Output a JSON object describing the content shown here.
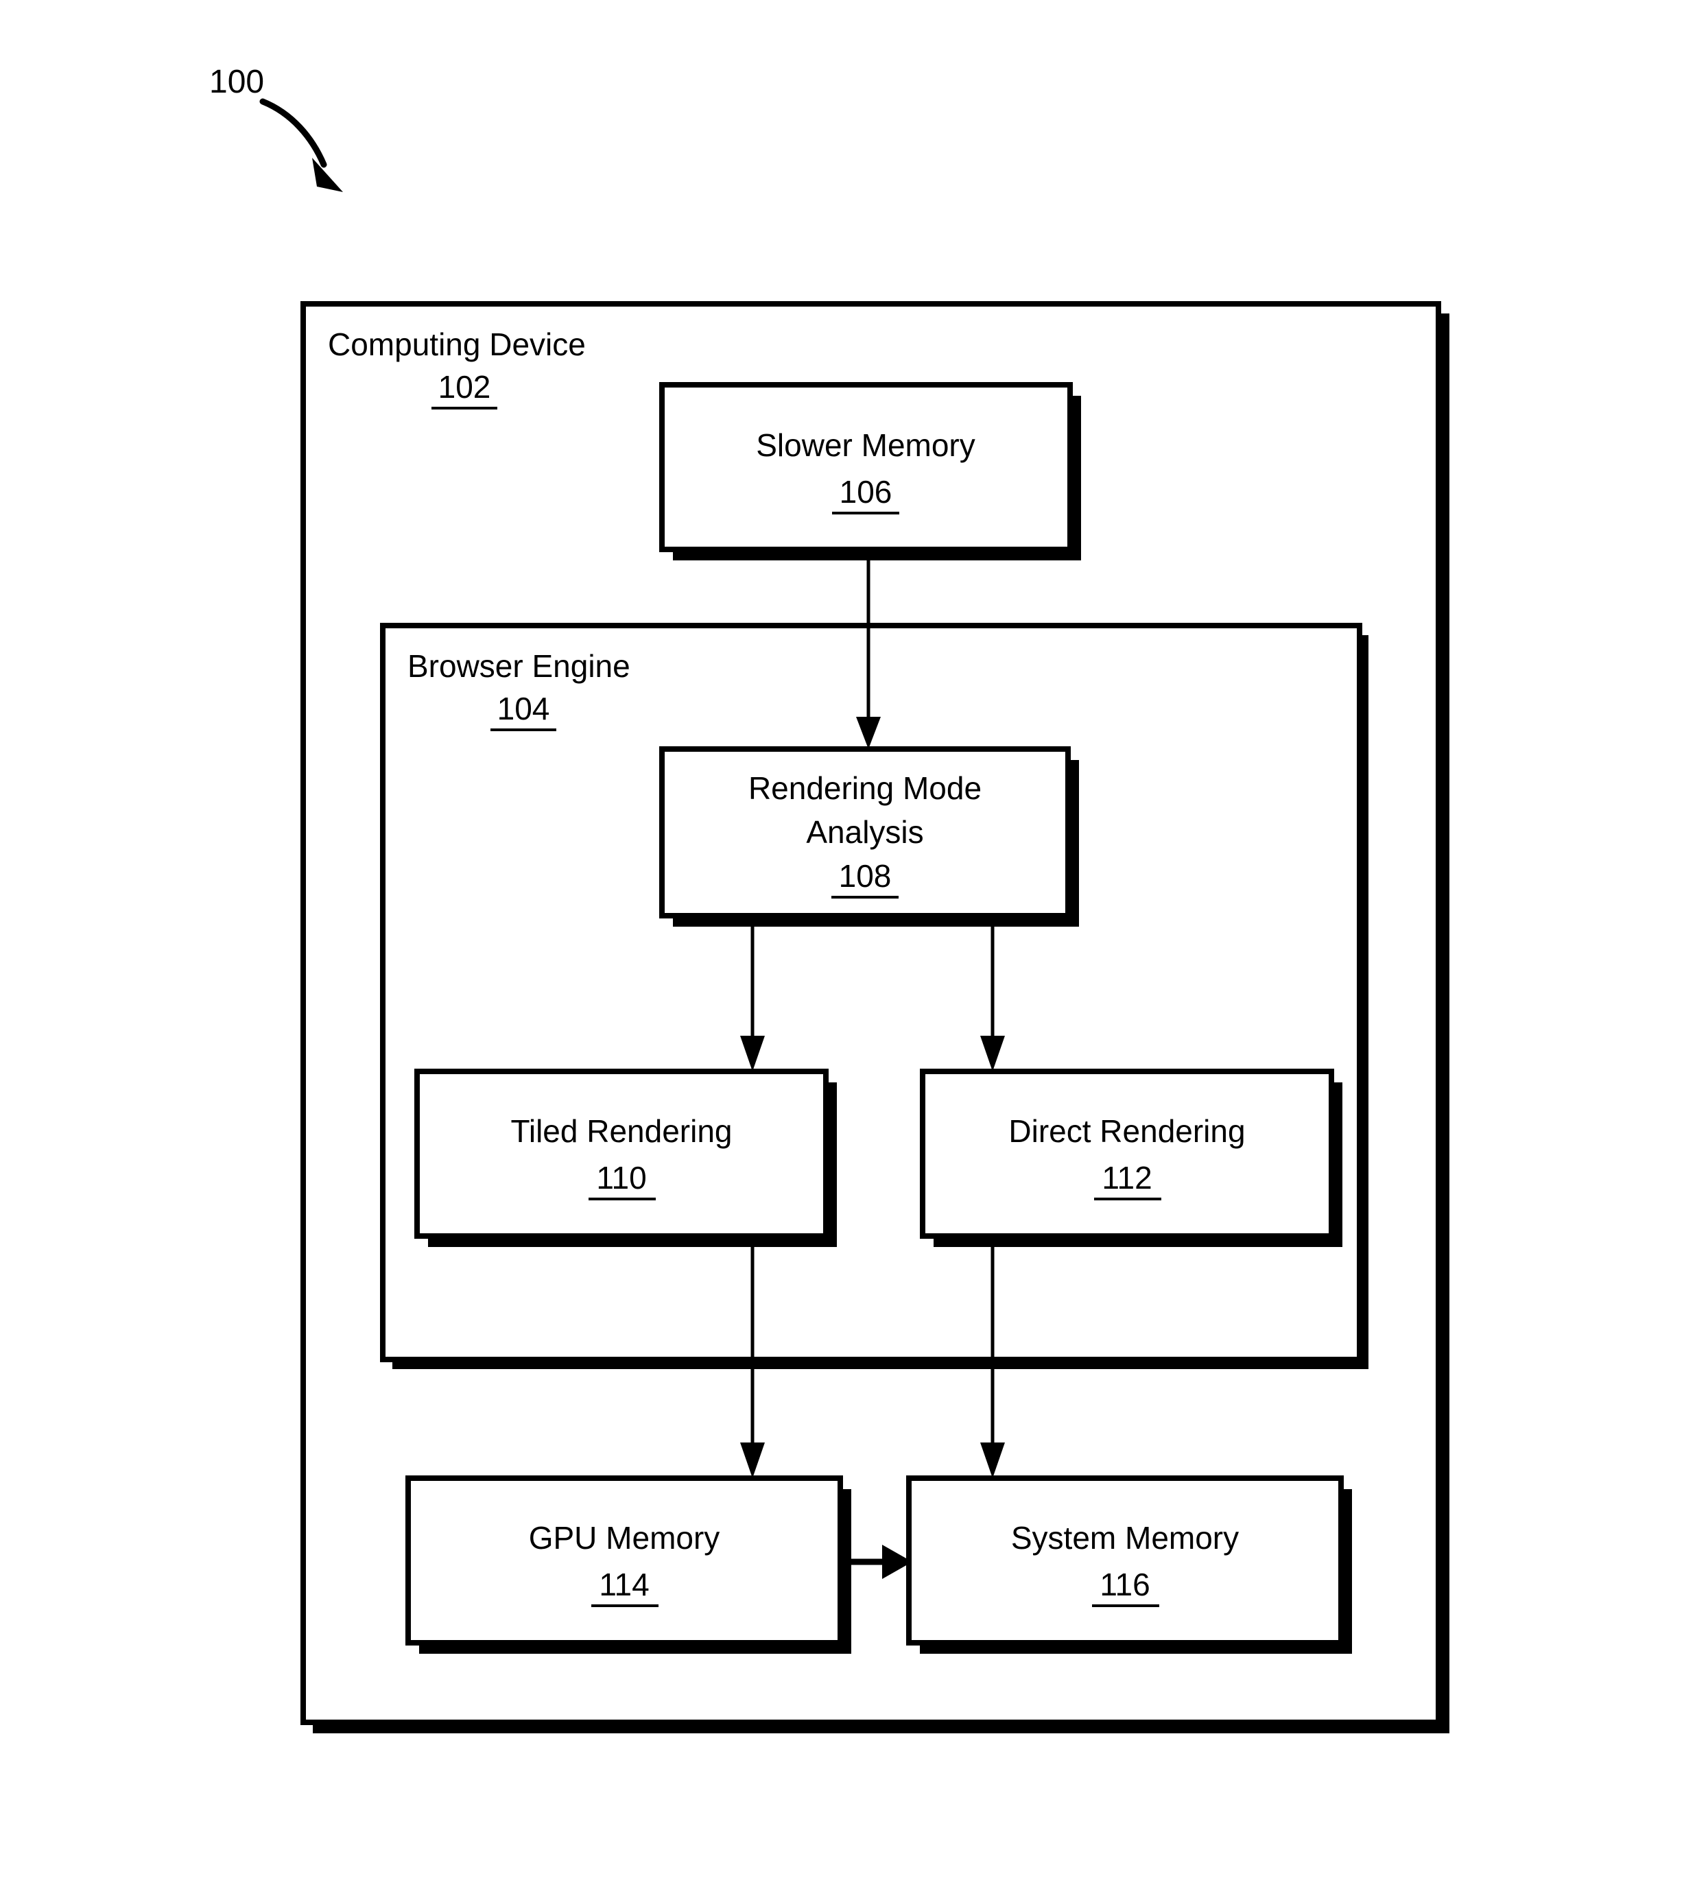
{
  "figure": {
    "number": "100",
    "type": "patent-block-diagram"
  },
  "containers": [
    {
      "id": "computing-device",
      "label": "Computing Device",
      "ref": "102"
    },
    {
      "id": "browser-engine",
      "label": "Browser Engine",
      "ref": "104"
    }
  ],
  "blocks": [
    {
      "id": "slower-memory",
      "label_line1": "Slower Memory",
      "label_line2": "",
      "ref": "106"
    },
    {
      "id": "rendering-mode-analysis",
      "label_line1": "Rendering Mode",
      "label_line2": "Analysis",
      "ref": "108"
    },
    {
      "id": "tiled-rendering",
      "label_line1": "Tiled Rendering",
      "label_line2": "",
      "ref": "110"
    },
    {
      "id": "direct-rendering",
      "label_line1": "Direct Rendering",
      "label_line2": "",
      "ref": "112"
    },
    {
      "id": "gpu-memory",
      "label_line1": "GPU Memory",
      "label_line2": "",
      "ref": "114"
    },
    {
      "id": "system-memory",
      "label_line1": "System Memory",
      "label_line2": "",
      "ref": "116"
    }
  ],
  "connections": [
    {
      "from": "slower-memory",
      "to": "rendering-mode-analysis",
      "direction": "down"
    },
    {
      "from": "rendering-mode-analysis",
      "to": "tiled-rendering",
      "direction": "down"
    },
    {
      "from": "rendering-mode-analysis",
      "to": "direct-rendering",
      "direction": "down"
    },
    {
      "from": "tiled-rendering",
      "to": "gpu-memory",
      "direction": "down"
    },
    {
      "from": "direct-rendering",
      "to": "system-memory",
      "direction": "down"
    },
    {
      "from": "gpu-memory",
      "to": "system-memory",
      "direction": "right"
    }
  ],
  "colors": {
    "stroke": "#000000",
    "fill": "#ffffff",
    "shadow": "#000000"
  }
}
